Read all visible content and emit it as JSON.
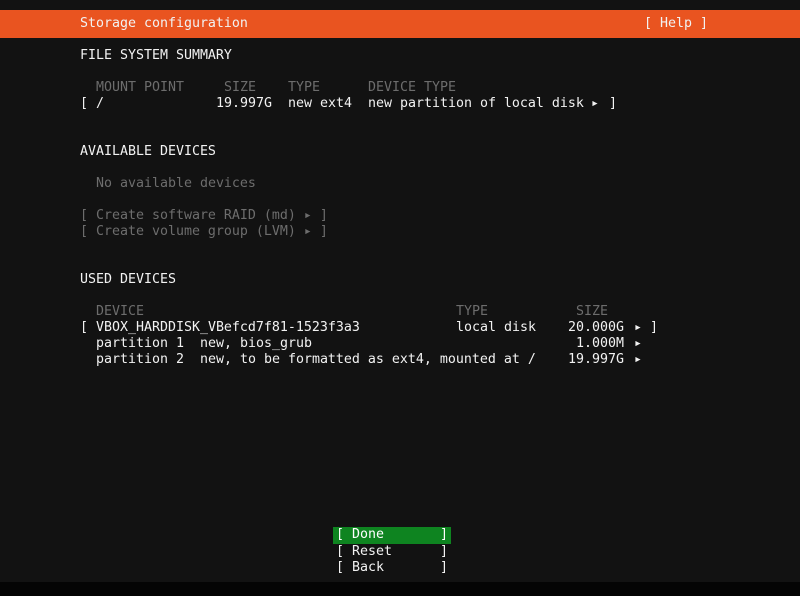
{
  "header": {
    "title": "Storage configuration",
    "help_button": "[ Help ]"
  },
  "symbols": {
    "open_bracket": "[",
    "close_bracket": "]",
    "arrow": "▸"
  },
  "colors": {
    "accent_orange": "#e95420",
    "focus_green": "#0e8420",
    "background": "#121212",
    "dim_text": "#6d6d6d",
    "text": "#f2f2f2"
  },
  "file_system_summary": {
    "heading": "FILE SYSTEM SUMMARY",
    "columns": {
      "mount_point": "MOUNT POINT",
      "size": "SIZE",
      "type": "TYPE",
      "device_type": "DEVICE TYPE"
    },
    "row": {
      "mount_point": "/",
      "size": "19.997G",
      "type": "new ext4",
      "device_type": "new partition of local disk"
    }
  },
  "available_devices": {
    "heading": "AVAILABLE DEVICES",
    "empty_text": "No available devices",
    "create_raid_button": "[ Create software RAID (md) ▸ ]",
    "create_lvm_button": "[ Create volume group (LVM) ▸ ]",
    "buttons_disabled": true
  },
  "used_devices": {
    "heading": "USED DEVICES",
    "columns": {
      "device": "DEVICE",
      "type": "TYPE",
      "size": "SIZE"
    },
    "disk_row": {
      "device": "VBOX_HARDDISK_VBefcd7f81-1523f3a3",
      "type": "local disk",
      "size": "20.000G"
    },
    "partition_rows": [
      {
        "device": "partition 1",
        "detail": "new, bios_grub",
        "size": "1.000M"
      },
      {
        "device": "partition 2",
        "detail": "new, to be formatted as ext4, mounted at /",
        "size": "19.997G"
      }
    ]
  },
  "footer": {
    "buttons": [
      {
        "name": "done",
        "display": "[ Done       ]",
        "focused": true
      },
      {
        "name": "reset",
        "display": "[ Reset      ]",
        "focused": false
      },
      {
        "name": "back",
        "display": "[ Back       ]",
        "focused": false
      }
    ]
  }
}
